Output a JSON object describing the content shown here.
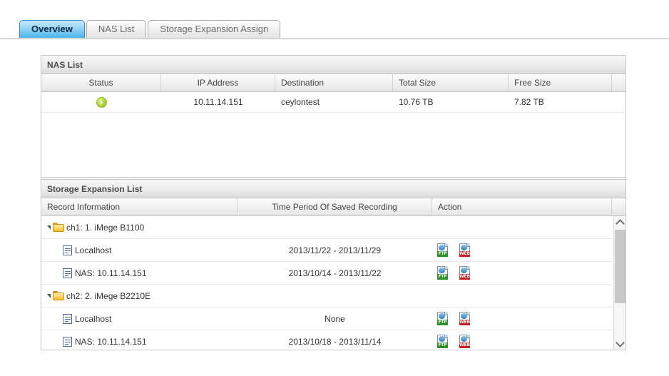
{
  "tabs": [
    {
      "label": "Overview",
      "active": true
    },
    {
      "label": "NAS List",
      "active": false
    },
    {
      "label": "Storage Expansion Assign",
      "active": false
    }
  ],
  "nas_panel": {
    "title": "NAS List",
    "columns": [
      "Status",
      "IP Address",
      "Destination",
      "Total Size",
      "Free Size"
    ],
    "rows": [
      {
        "status_icon": "power-bolt-icon",
        "ip_address": "10.11.14.151",
        "destination": "ceylontest",
        "total_size": "10.76 TB",
        "free_size": "7.82 TB"
      }
    ]
  },
  "storage_panel": {
    "title": "Storage Expansion List",
    "columns": [
      "Record Information",
      "Time Period Of Saved Recording",
      "Action"
    ],
    "tree": [
      {
        "type": "group",
        "icon": "folder-icon",
        "label": "ch1: 1. iMege B1100",
        "expanded": true,
        "time_period": "",
        "children": [
          {
            "type": "leaf",
            "icon": "record-doc-icon",
            "label": "Localhost",
            "time_period": "2013/11/22 - 2013/11/29",
            "actions": [
              "FTP",
              "WEB"
            ]
          },
          {
            "type": "leaf",
            "icon": "record-doc-icon",
            "label": "NAS: 10.11.14.151",
            "time_period": "2013/10/14 - 2013/11/22",
            "actions": [
              "FTP",
              "WEB"
            ]
          }
        ]
      },
      {
        "type": "group",
        "icon": "folder-icon",
        "label": "ch2: 2. iMege B2210E",
        "expanded": true,
        "time_period": "",
        "children": [
          {
            "type": "leaf",
            "icon": "record-doc-icon",
            "label": "Localhost",
            "time_period": "None",
            "actions": [
              "FTP",
              "WEB"
            ]
          },
          {
            "type": "leaf",
            "icon": "record-doc-icon",
            "label": "NAS: 10.11.14.151",
            "time_period": "2013/10/18 - 2013/11/14",
            "actions": [
              "FTP",
              "WEB"
            ]
          }
        ]
      }
    ],
    "action_labels": {
      "ftp": "FTP",
      "web": "WEB"
    }
  },
  "colors": {
    "active_tab_accent": "#49b3ec",
    "status_green": "#a8ce32",
    "ftp_green": "#2c8f2c",
    "web_red": "#c02222",
    "folder_orange": "#fdd468",
    "panel_border": "#c6c6c6"
  }
}
